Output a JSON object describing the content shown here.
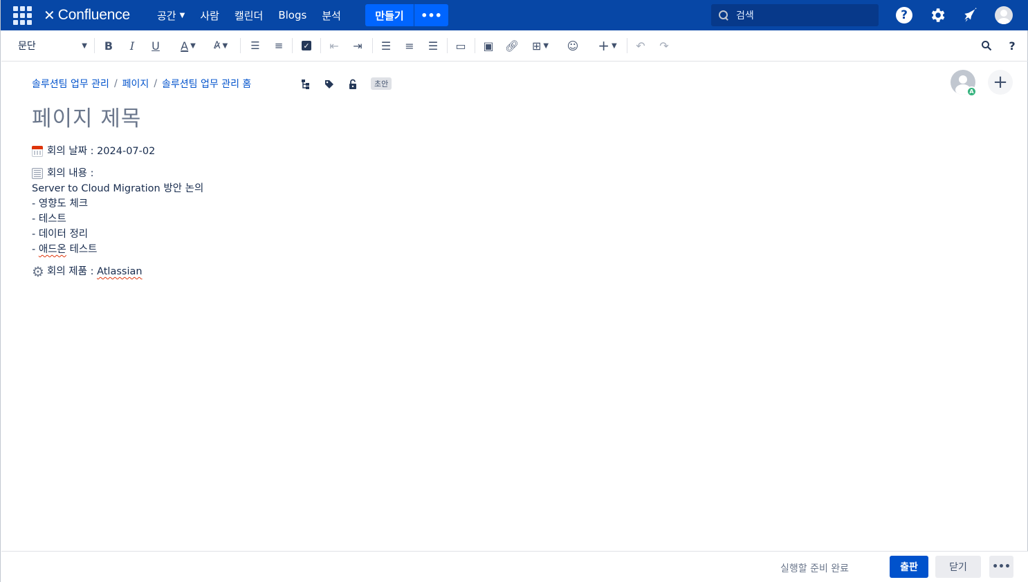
{
  "topnav": {
    "app_switcher_icon": "grid-icon",
    "logo_text": "Confluence",
    "items": [
      {
        "label": "공간",
        "has_dropdown": true
      },
      {
        "label": "사람",
        "has_dropdown": false
      },
      {
        "label": "캘린더",
        "has_dropdown": false
      },
      {
        "label": "Blogs",
        "has_dropdown": false
      },
      {
        "label": "분석",
        "has_dropdown": false
      }
    ],
    "create_label": "만들기",
    "create_more_label": "•••",
    "search_placeholder": "검색",
    "icons": [
      "help-icon",
      "gear-icon",
      "notification-icon",
      "avatar-icon"
    ],
    "color_bg": "#0747a6",
    "color_accent": "#0065ff"
  },
  "toolbar": {
    "paragraph_select": "문단",
    "buttons": [
      "bold",
      "italic",
      "underline",
      "text-color",
      "text-format",
      "bullet-list",
      "numbered-list",
      "task-list",
      "outdent",
      "indent",
      "align-left",
      "align-center",
      "align-right",
      "page-layout",
      "image",
      "link",
      "table",
      "emoji",
      "insert-more",
      "undo",
      "redo",
      "find-replace",
      "help"
    ]
  },
  "breadcrumb": {
    "items": [
      "솔루션팀 업무 관리",
      "페이지",
      "솔루션팀 업무 관리 홈"
    ],
    "separator": "/",
    "draft_label": "초안"
  },
  "page": {
    "title_placeholder": "페이지 제목",
    "lines": {
      "date": "회의 날짜 : 2024-07-02",
      "content_label": "회의 내용 :",
      "content_1": "Server to Cloud Migration 방안 논의",
      "content_2": "- 영향도 체크",
      "content_3": "- 테스트",
      "content_4": "- 데이터 정리",
      "content_5_prefix": "- ",
      "content_5_misspelled": "애드온",
      "content_5_suffix": " 테스트",
      "product_prefix": "회의 제품 : ",
      "product_misspelled": "Atlassian"
    }
  },
  "collaborator": {
    "badge": "A"
  },
  "footer": {
    "status": "실행할 준비 완료",
    "publish_label": "출판",
    "close_label": "닫기",
    "more_label": "•••"
  }
}
